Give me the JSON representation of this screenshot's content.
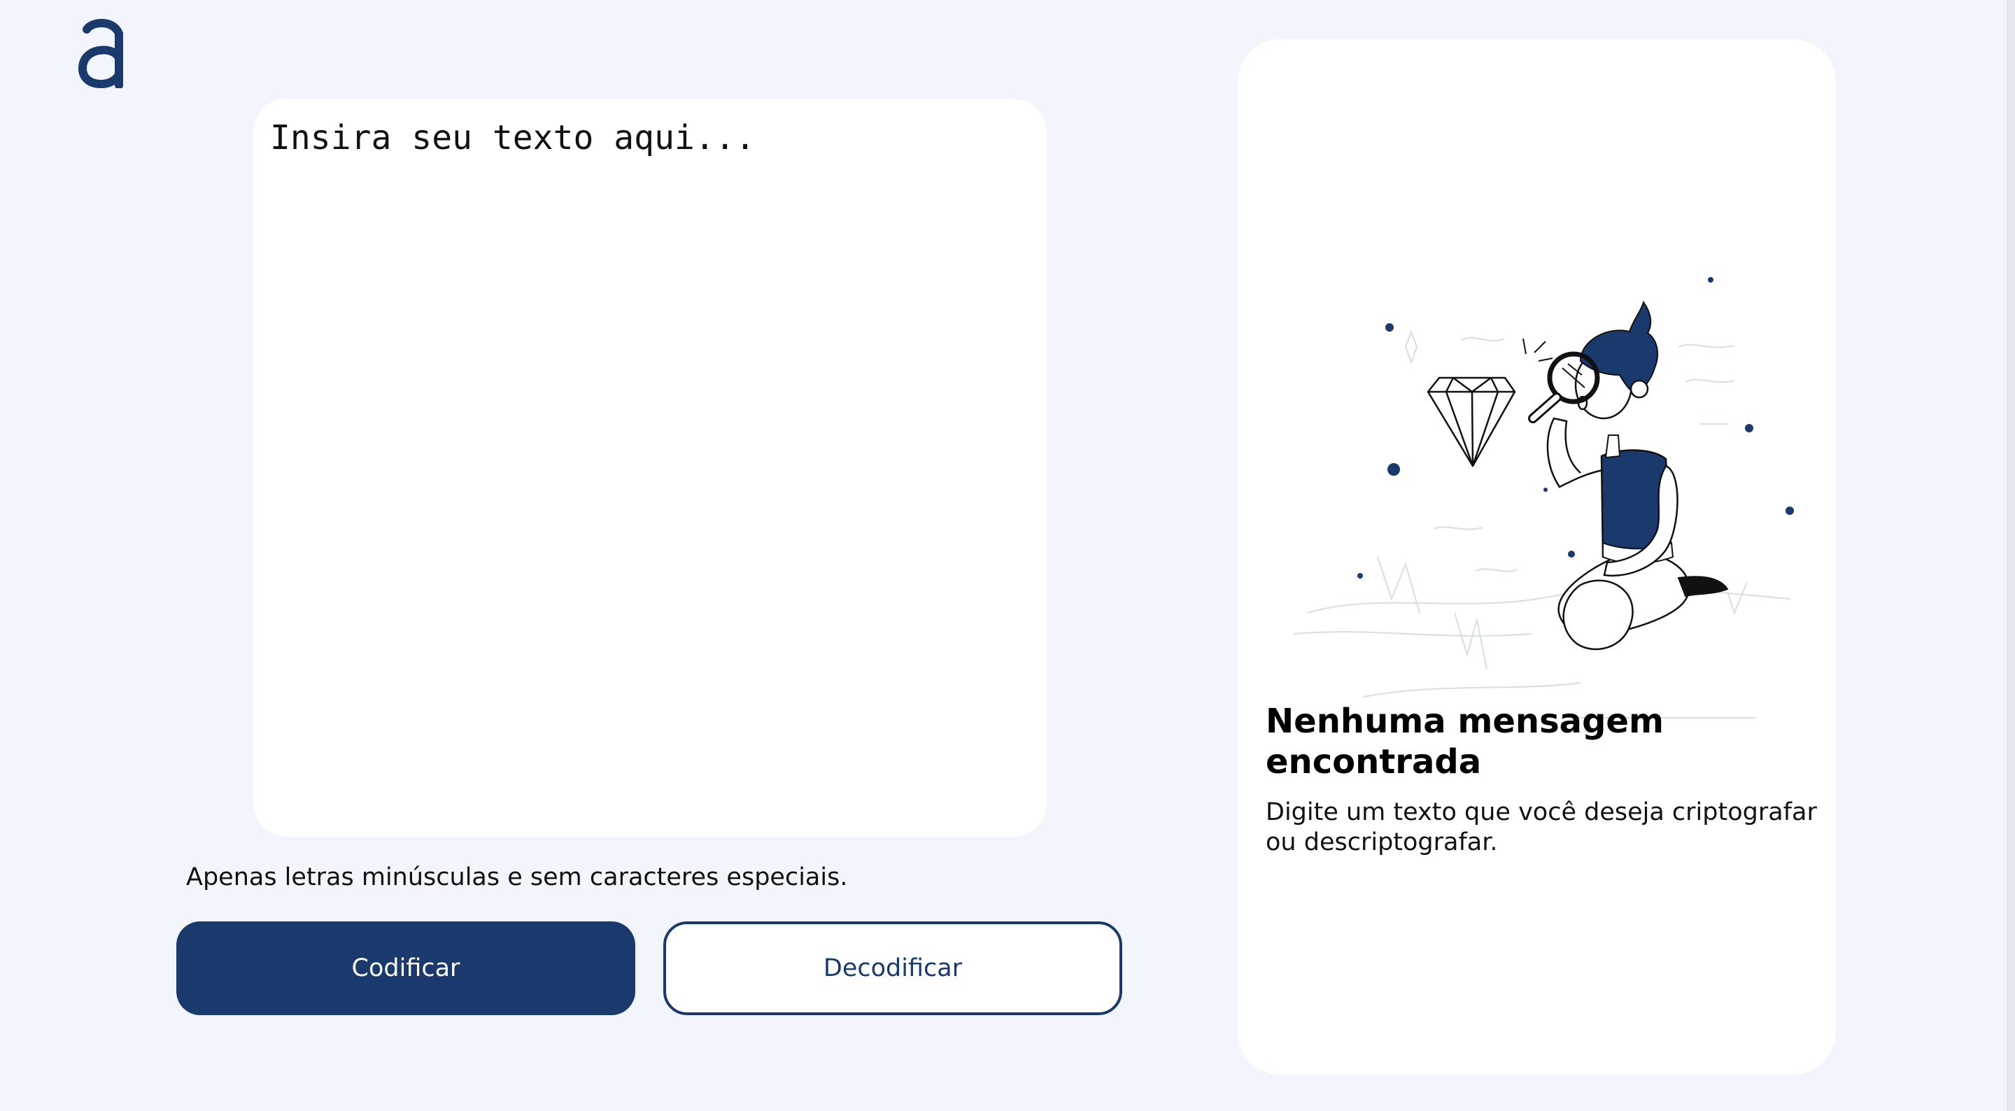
{
  "colors": {
    "background": "#F3F5FC",
    "primary": "#1A3A6E",
    "panel": "#FFFFFF"
  },
  "logo": {
    "icon": "alura-a-logo-icon"
  },
  "input": {
    "placeholder": "Insira seu texto aqui..."
  },
  "hint": {
    "icon": "info-icon",
    "text": "Apenas letras minúsculas e sem caracteres especiais."
  },
  "buttons": {
    "encrypt_label": "Codificar",
    "decrypt_label": "Decodificar"
  },
  "output": {
    "illustration": "person-searching-with-magnifier-illustration",
    "title": "Nenhuma mensagem encontrada",
    "subtitle": "Digite um texto que você deseja criptografar ou descriptografar."
  }
}
